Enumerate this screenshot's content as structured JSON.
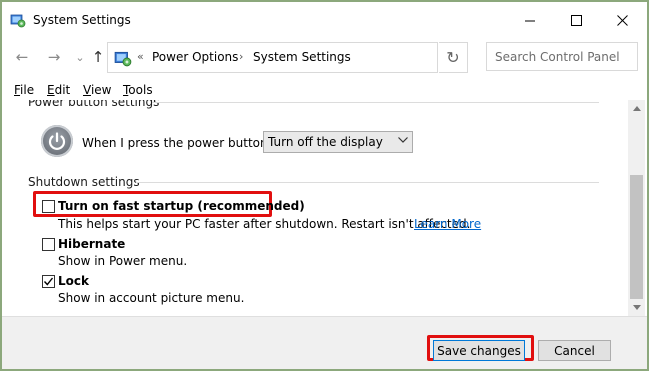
{
  "window": {
    "title": "System Settings",
    "controls": {
      "minimize": "—",
      "maximize": "☐",
      "close": "✕"
    }
  },
  "nav": {
    "back": "←",
    "forward": "→",
    "recent": "⌄",
    "up": "↑",
    "breadcrumb": {
      "overflow": "«",
      "items": [
        "Power Options",
        "System Settings"
      ],
      "separator": "›"
    },
    "refresh": "↻",
    "search_placeholder": "Search Control Panel"
  },
  "menu": {
    "items": [
      {
        "key": "F",
        "rest": "ile"
      },
      {
        "key": "E",
        "rest": "dit"
      },
      {
        "key": "V",
        "rest": "iew"
      },
      {
        "key": "T",
        "rest": "ools"
      }
    ]
  },
  "content": {
    "power_section_header": "Power button settings",
    "power_label": "When I press the power button:",
    "power_select_value": "Turn off the display",
    "shutdown_section_header": "Shutdown settings",
    "options": [
      {
        "label": "Turn on fast startup (recommended)",
        "description": "This helps start your PC faster after shutdown. Restart isn't affected.",
        "link": "Learn More",
        "checked": false
      },
      {
        "label": "Hibernate",
        "description": "Show in Power menu.",
        "checked": false
      },
      {
        "label": "Lock",
        "description": "Show in account picture menu.",
        "checked": true
      }
    ]
  },
  "footer": {
    "save": "Save changes",
    "cancel": "Cancel"
  },
  "colors": {
    "highlight": "#e10f0f",
    "link": "#0066cc",
    "frame": "#8ca87c"
  }
}
